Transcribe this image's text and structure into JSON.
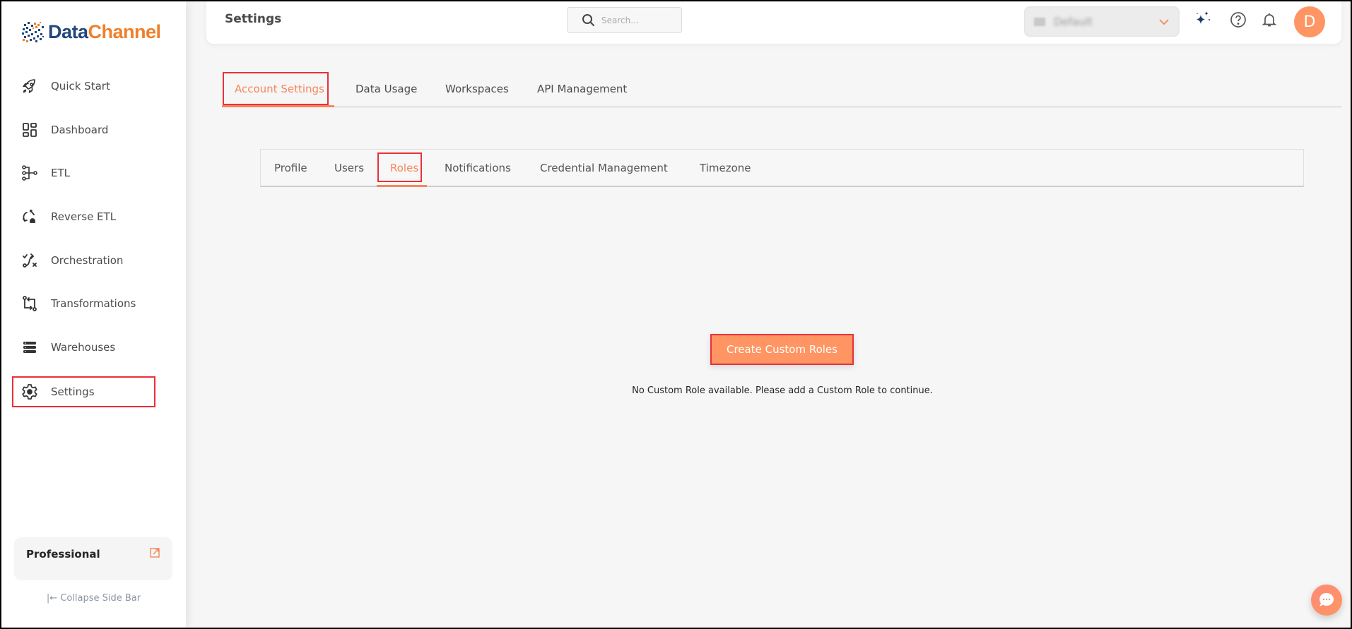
{
  "brand": {
    "name_part1": "Data",
    "name_part2": "Channel",
    "color_blue": "#22467d",
    "color_orange": "#f07f2b"
  },
  "sidebar": {
    "items": [
      {
        "label": "Quick Start",
        "icon": "rocket-icon"
      },
      {
        "label": "Dashboard",
        "icon": "dashboard-icon"
      },
      {
        "label": "ETL",
        "icon": "etl-icon"
      },
      {
        "label": "Reverse ETL",
        "icon": "reverse-etl-icon"
      },
      {
        "label": "Orchestration",
        "icon": "orchestration-icon"
      },
      {
        "label": "Transformations",
        "icon": "transformations-icon"
      },
      {
        "label": "Warehouses",
        "icon": "warehouses-icon"
      },
      {
        "label": "Settings",
        "icon": "gear-icon",
        "active": true
      }
    ],
    "plan": {
      "name": "Professional",
      "icon": "external-link-icon"
    },
    "collapse_label": "|← Collapse Side Bar"
  },
  "header": {
    "title": "Settings",
    "search": {
      "placeholder": "Search...",
      "value": ""
    },
    "workspace": {
      "selected": "Default",
      "icon": "building-icon"
    },
    "icons": [
      "sparkle-icon",
      "help-icon",
      "bell-icon"
    ],
    "avatar_initial": "D"
  },
  "main_tabs": [
    {
      "label": "Account Settings",
      "active": true
    },
    {
      "label": "Data Usage"
    },
    {
      "label": "Workspaces"
    },
    {
      "label": "API Management"
    }
  ],
  "sub_tabs": [
    {
      "label": "Profile"
    },
    {
      "label": "Users"
    },
    {
      "label": "Roles",
      "active": true
    },
    {
      "label": "Notifications"
    },
    {
      "label": "Credential Management"
    },
    {
      "label": "Timezone"
    }
  ],
  "empty_state": {
    "button_label": "Create Custom Roles",
    "message": "No Custom Role available. Please add a Custom Role to continue."
  },
  "colors": {
    "accent": "#f5875c",
    "button": "#fe9563",
    "highlight": "#e8303a"
  }
}
